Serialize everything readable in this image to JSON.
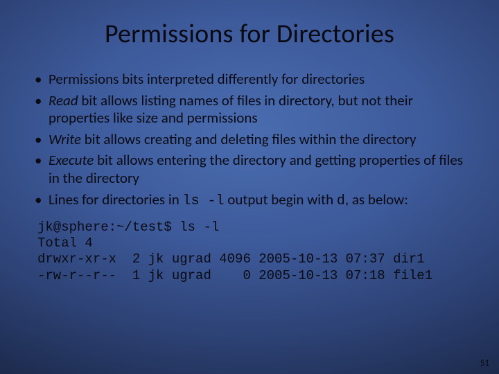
{
  "title": "Permissions for Directories",
  "bullets": [
    {
      "pre": "",
      "em": "",
      "post": "Permissions bits interpreted differently for directories"
    },
    {
      "pre": "",
      "em": "Read",
      "post": " bit allows listing names of files in directory, but not their properties like size and permissions"
    },
    {
      "pre": "",
      "em": "Write",
      "post": " bit allows creating and deleting files within the directory"
    },
    {
      "pre": "",
      "em": "Execute",
      "post": " bit allows entering the directory and getting properties of files in the directory"
    },
    {
      "pre": "Lines for directories in ",
      "code": "ls -l",
      "post2": " output begin with ",
      "code2": "d",
      "post3": ", as below:"
    }
  ],
  "terminal": {
    "line1": "jk@sphere:~/test$ ls -l",
    "line2": "Total 4",
    "line3": "drwxr-xr-x  2 jk ugrad 4096 2005-10-13 07:37 dir1",
    "line4": "-rw-r--r--  1 jk ugrad    0 2005-10-13 07:18 file1"
  },
  "pagenum": "51"
}
